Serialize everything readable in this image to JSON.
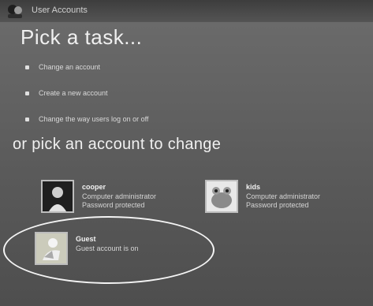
{
  "window": {
    "title": "User Accounts"
  },
  "tasks": {
    "heading": "Pick a task...",
    "items": [
      {
        "label": "Change an account"
      },
      {
        "label": "Create a new account"
      },
      {
        "label": "Change the way users log on or off"
      }
    ]
  },
  "accounts": {
    "heading": "or pick an account to change",
    "items": [
      {
        "name": "cooper",
        "line1": "Computer administrator",
        "line2": "Password protected"
      },
      {
        "name": "kids",
        "line1": "Computer administrator",
        "line2": "Password protected"
      },
      {
        "name": "Guest",
        "line1": "Guest account is on"
      }
    ]
  },
  "colors": {
    "background": "#5c5c5c",
    "highlight_ellipse": "#f4f4f4"
  }
}
